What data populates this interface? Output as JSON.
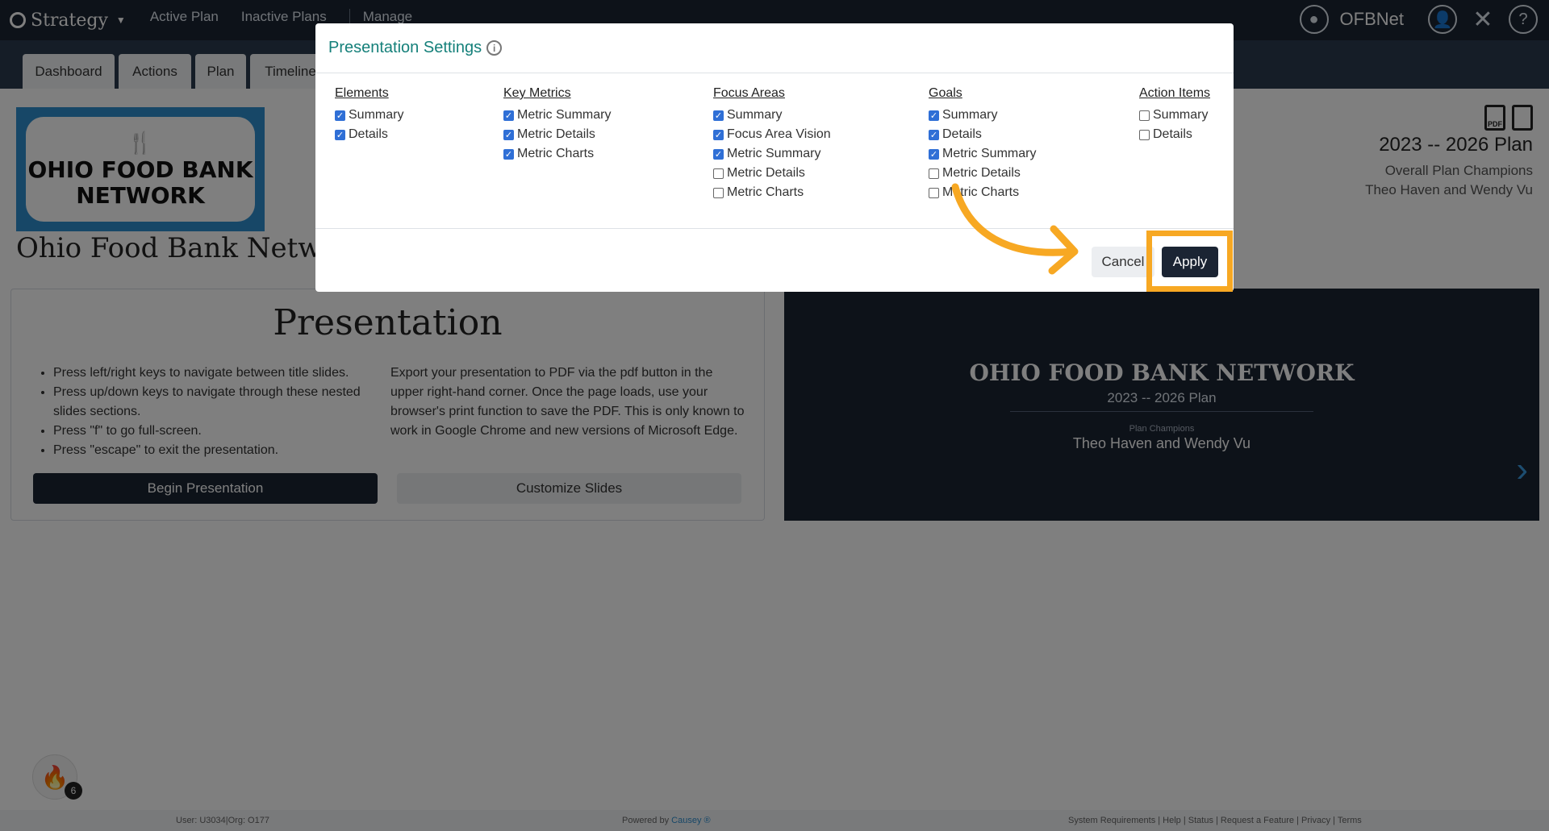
{
  "nav": {
    "brand": "Strategy",
    "links": [
      "Active Plan",
      "Inactive Plans",
      "Manage"
    ],
    "org_label": "OFBNet"
  },
  "tabs": [
    "Dashboard",
    "Actions",
    "Plan",
    "Timeline"
  ],
  "logo": {
    "line1": "OHIO FOOD BANK",
    "line2": "NETWORK"
  },
  "org_name": "Ohio Food Bank Network",
  "plan": {
    "years": "2023 -- 2026 Plan",
    "champions_label": "Overall Plan Champions",
    "champions": "Theo Haven and Wendy Vu",
    "pdf_badge": "PDF"
  },
  "presentation": {
    "title": "Presentation",
    "instructions": [
      "Press left/right keys to navigate between title slides.",
      "Press up/down keys to navigate through these nested slides sections.",
      "Press \"f\" to go full-screen.",
      "Press \"escape\" to exit the presentation."
    ],
    "export_text": "Export your presentation to PDF via the pdf button in the upper right-hand corner. Once the page loads, use your browser's print function to save the PDF. This is only known to work in Google Chrome and new versions of Microsoft Edge.",
    "begin_label": "Begin Presentation",
    "customize_label": "Customize Slides"
  },
  "slide": {
    "title": "OHIO FOOD BANK NETWORK",
    "plan": "2023 -- 2026 Plan",
    "champions_label": "Plan Champions",
    "champions": "Theo Haven and Wendy Vu"
  },
  "footer": {
    "user": "User: U3034|Org: O177",
    "powered_prefix": "Powered by ",
    "powered_brand": "Causey ®",
    "links": "System Requirements | Help | Status | Request a Feature | Privacy | Terms"
  },
  "flame_badge": "6",
  "modal": {
    "title": "Presentation Settings",
    "columns": [
      {
        "heading": "Elements",
        "items": [
          {
            "label": "Summary",
            "checked": true
          },
          {
            "label": "Details",
            "checked": true
          }
        ]
      },
      {
        "heading": "Key Metrics",
        "items": [
          {
            "label": "Metric Summary",
            "checked": true
          },
          {
            "label": "Metric Details",
            "checked": true
          },
          {
            "label": "Metric Charts",
            "checked": true
          }
        ]
      },
      {
        "heading": "Focus Areas",
        "items": [
          {
            "label": "Summary",
            "checked": true
          },
          {
            "label": "Focus Area Vision",
            "checked": true
          },
          {
            "label": "Metric Summary",
            "checked": true
          },
          {
            "label": "Metric Details",
            "checked": false
          },
          {
            "label": "Metric Charts",
            "checked": false
          }
        ]
      },
      {
        "heading": "Goals",
        "items": [
          {
            "label": "Summary",
            "checked": true
          },
          {
            "label": "Details",
            "checked": true
          },
          {
            "label": "Metric Summary",
            "checked": true
          },
          {
            "label": "Metric Details",
            "checked": false
          },
          {
            "label": "Metric Charts",
            "checked": false
          }
        ]
      },
      {
        "heading": "Action Items",
        "items": [
          {
            "label": "Summary",
            "checked": false
          },
          {
            "label": "Details",
            "checked": false
          }
        ]
      }
    ],
    "cancel_label": "Cancel",
    "apply_label": "Apply"
  },
  "colors": {
    "nav_bg": "#1b2433",
    "accent_teal": "#15807a",
    "highlight": "#f7a823",
    "checkbox": "#2f6fd6"
  }
}
